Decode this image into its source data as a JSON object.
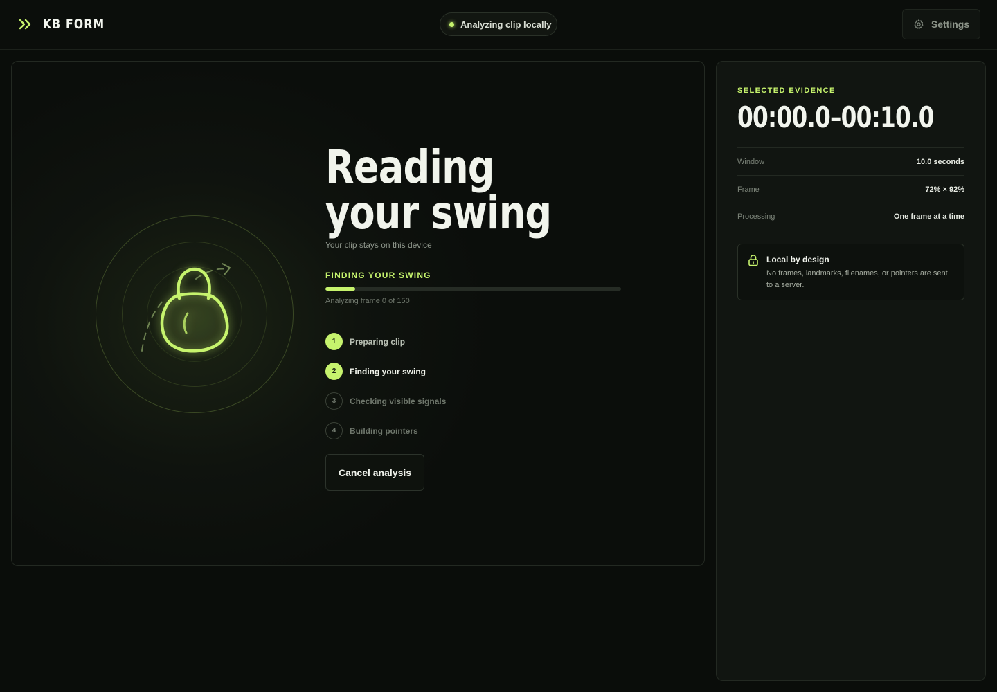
{
  "header": {
    "brand_name": "KB FORM",
    "status_text": "Analyzing clip locally",
    "settings_label": "Settings"
  },
  "main": {
    "title": "Reading your swing",
    "subtitle": "Your clip stays on this device",
    "phase_label": "FINDING YOUR SWING",
    "progress": 0.1,
    "frame_counter": "Analyzing frame 0 of 150",
    "steps": [
      {
        "num": "1",
        "label": "Preparing clip",
        "state": "done"
      },
      {
        "num": "2",
        "label": "Finding your swing",
        "state": "active"
      },
      {
        "num": "3",
        "label": "Checking visible signals",
        "state": "pending"
      },
      {
        "num": "4",
        "label": "Building pointers",
        "state": "pending"
      }
    ],
    "cancel_label": "Cancel analysis"
  },
  "side": {
    "evidence_label": "SELECTED EVIDENCE",
    "evidence_range": "00:00.0–00:10.0",
    "meta": [
      {
        "key": "Window",
        "value": "10.0 seconds"
      },
      {
        "key": "Frame",
        "value": "72% × 92%"
      },
      {
        "key": "Processing",
        "value": "One frame at a time"
      }
    ],
    "privacy_title": "Local by design",
    "privacy_body": "No frames, landmarks, filenames, or pointers are sent to a server."
  },
  "colors": {
    "accent": "#c6f36d",
    "background": "#0a0d0a",
    "panel": "#111511"
  },
  "icons": [
    "chevrons-right-icon",
    "gear-icon",
    "kettlebell-icon",
    "lock-icon"
  ]
}
